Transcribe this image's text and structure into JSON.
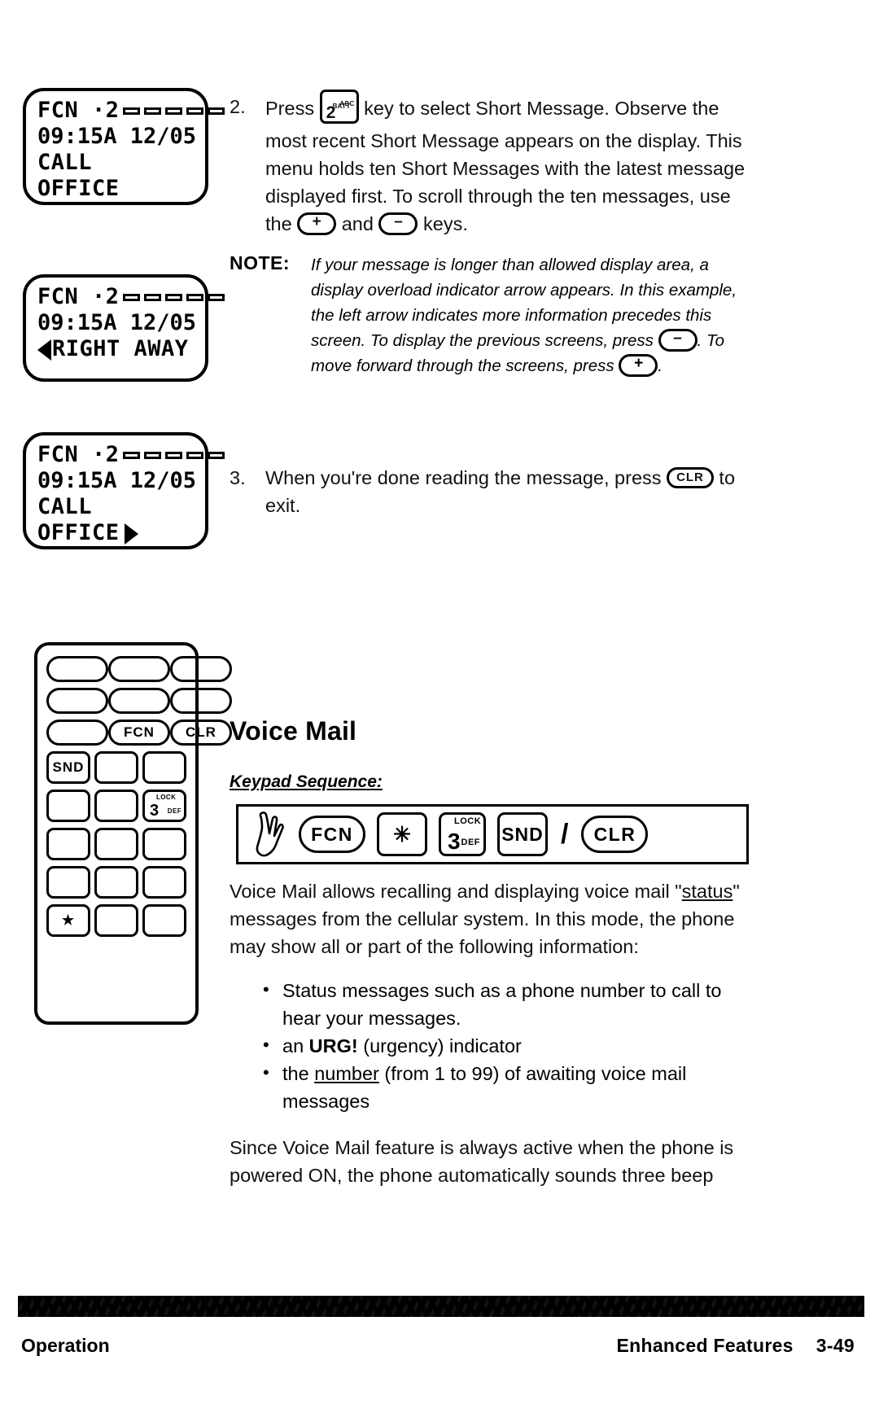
{
  "displays": [
    {
      "name": "short-message-first",
      "line1_prefix": "FCN ·2",
      "bars": 5,
      "line2": "09:15A 12/05",
      "line3": "CALL",
      "line4": "OFFICE",
      "arrow_left": false,
      "arrow_right": false
    },
    {
      "name": "short-message-overflow",
      "line1_prefix": "FCN ·2",
      "bars": 5,
      "line2": "09:15A 12/05",
      "line3": "RIGHT AWAY",
      "line4": "",
      "arrow_left": true,
      "arrow_right": false
    },
    {
      "name": "short-message-exit",
      "line1_prefix": "FCN ·2",
      "bars": 5,
      "line2": "09:15A 12/05",
      "line3": "CALL",
      "line4": "OFFICE",
      "arrow_left": false,
      "arrow_right": true
    }
  ],
  "step2": {
    "number": "2.",
    "text_a": "Press",
    "key": {
      "digit": "2",
      "top": "BATT",
      "side": "ABC"
    },
    "text_b": "key to select Short Message.  Observe the most recent Short Message appears on the display.  This menu holds ten Short Messages with the latest message displayed first.  To scroll through the ten messages, use the",
    "plus_key": "+",
    "text_c": "and",
    "minus_key": "–",
    "text_d": "keys."
  },
  "note": {
    "label": "NOTE:",
    "text_a": "If your message is longer than allowed display area, a display overload indicator arrow appears.  In this example, the left arrow indicates more information precedes this screen.   To display the previous screens, press",
    "minus_key": "–",
    "text_b": ".  To move forward through the screens, press",
    "plus_key": "+",
    "text_c": "."
  },
  "step3": {
    "number": "3.",
    "text_a": "When you're done reading the message, press",
    "clr_key": "CLR",
    "text_b": "to exit."
  },
  "phone_keypad": {
    "rows": [
      [
        {
          "label": "",
          "shape": "pill"
        },
        {
          "label": "",
          "shape": "pill"
        },
        {
          "label": "",
          "shape": "pill"
        }
      ],
      [
        {
          "label": "",
          "shape": "pill"
        },
        {
          "label": "",
          "shape": "pill"
        },
        {
          "label": "",
          "shape": "pill"
        }
      ],
      [
        {
          "label": "",
          "shape": "pill"
        },
        {
          "label": "FCN",
          "shape": "pill"
        },
        {
          "label": "CLR",
          "shape": "pill"
        }
      ],
      [
        {
          "label": "SND",
          "shape": "sqr"
        },
        {
          "label": "",
          "shape": "sqr"
        },
        {
          "label": "",
          "shape": "sqr"
        }
      ],
      [
        {
          "label": "",
          "shape": "sqr"
        },
        {
          "label": "",
          "shape": "sqr"
        },
        {
          "label": "3",
          "shape": "k3",
          "top": "LOCK",
          "side": "DEF"
        }
      ],
      [
        {
          "label": "",
          "shape": "sqr"
        },
        {
          "label": "",
          "shape": "sqr"
        },
        {
          "label": "",
          "shape": "sqr"
        }
      ],
      [
        {
          "label": "",
          "shape": "sqr"
        },
        {
          "label": "",
          "shape": "sqr"
        },
        {
          "label": "",
          "shape": "sqr"
        }
      ],
      [
        {
          "label": "★",
          "shape": "sqr"
        },
        {
          "label": "",
          "shape": "sqr"
        },
        {
          "label": "",
          "shape": "sqr"
        }
      ]
    ]
  },
  "voice_mail": {
    "title": "Voice Mail",
    "keypad_sequence_label": "Keypad Sequence:",
    "sequence": [
      {
        "type": "hand",
        "label": "press-hand"
      },
      {
        "type": "pill",
        "label": "FCN"
      },
      {
        "type": "square",
        "label": "✳"
      },
      {
        "type": "square3",
        "label": "3",
        "top": "LOCK",
        "side": "DEF"
      },
      {
        "type": "square",
        "label": "SND"
      },
      {
        "type": "slash",
        "label": "/"
      },
      {
        "type": "pill",
        "label": "CLR"
      }
    ],
    "paragraph1_a": "Voice Mail allows recalling and displaying voice mail \"",
    "paragraph1_underline": "status",
    "paragraph1_b": "\" messages from the cellular system.  In this mode, the phone may show all or part of the following information:",
    "bullets": [
      {
        "a": "Status messages such as a phone number to call to hear your messages.",
        "b": "",
        "c": ""
      },
      {
        "a": "an ",
        "bold": "URG!",
        "c": " (urgency) indicator"
      },
      {
        "a": "the ",
        "underline": "number",
        "c": " (from 1 to 99) of awaiting voice mail messages"
      }
    ],
    "paragraph2": "Since Voice Mail feature is always active when the phone is powered ON, the phone automatically sounds three beep"
  },
  "footer": {
    "left": "Operation",
    "right": "Enhanced Features",
    "page": "3-49"
  }
}
